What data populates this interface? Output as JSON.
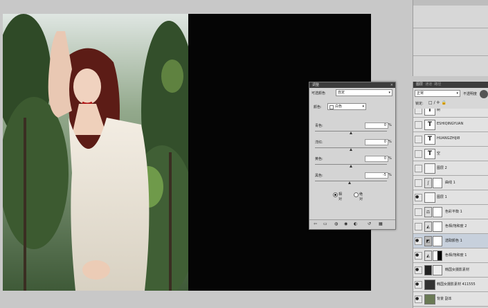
{
  "adjustments": {
    "tabs": [
      "调整"
    ],
    "preset_label": "可选颜色",
    "preset_value": "自定",
    "colors_label": "颜色:",
    "colors_value": "白色",
    "sliders": [
      {
        "label": "青色:",
        "value": "0",
        "unit": "%"
      },
      {
        "label": "洋红:",
        "value": "0",
        "unit": "%"
      },
      {
        "label": "黄色:",
        "value": "0",
        "unit": "%"
      },
      {
        "label": "黑色:",
        "value": "-5",
        "unit": "%"
      }
    ],
    "method_relative": "相对",
    "method_absolute": "绝对"
  },
  "layers": {
    "tabs": [
      "图层",
      "通道",
      "路径"
    ],
    "blend_mode": "正常",
    "opacity_label": "不透明度",
    "lock_label": "锁定:",
    "items": [
      {
        "name": "树",
        "type": "text"
      },
      {
        "name": "ESHIQINGYUAN",
        "type": "text"
      },
      {
        "name": "HUANGZHIJI8",
        "type": "text"
      },
      {
        "name": "空",
        "type": "text"
      },
      {
        "name": "图层 2",
        "type": "pixel"
      },
      {
        "name": "曲线 1",
        "type": "adjust"
      },
      {
        "name": "图层 1",
        "type": "pixel"
      },
      {
        "name": "色彩平衡 1",
        "type": "adjust"
      },
      {
        "name": "色相/饱和度 2",
        "type": "adjust"
      },
      {
        "name": "选取颜色 1",
        "type": "adjust"
      },
      {
        "name": "色相/饱和度 1",
        "type": "adjust"
      },
      {
        "name": "韩国女摄影素材",
        "type": "pixel"
      },
      {
        "name": "韩国女摄影素材 411555",
        "type": "pixel"
      },
      {
        "name": "背景 副本",
        "type": "pixel"
      }
    ]
  }
}
